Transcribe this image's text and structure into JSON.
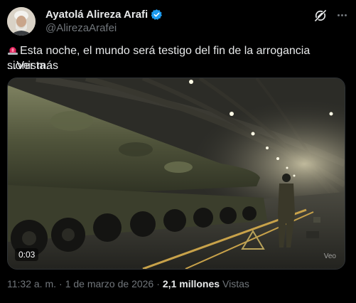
{
  "author": {
    "display_name": "Ayatolá Alireza Arafi",
    "handle": "@AlirezaArafei"
  },
  "icons": {
    "verified": "verified-badge-icon",
    "grok": "grok-icon",
    "more": "more-options-icon",
    "siren": "rotating-light-emoji"
  },
  "tweet": {
    "text": "Esta noche, el mundo será testigo del fin de la arrogancia sionista.",
    "show_more": "...Ver más"
  },
  "media": {
    "duration": "0:03",
    "watermark": "Veo"
  },
  "meta": {
    "time": "11:32 a. m.",
    "separator": "·",
    "date": "1 de marzo de 2026",
    "views_count": "2,1 millones",
    "views_label": "Vistas"
  },
  "colors": {
    "background": "#000000",
    "text": "#e7e9ea",
    "muted": "#71767b",
    "verified": "#1d9bf0"
  }
}
